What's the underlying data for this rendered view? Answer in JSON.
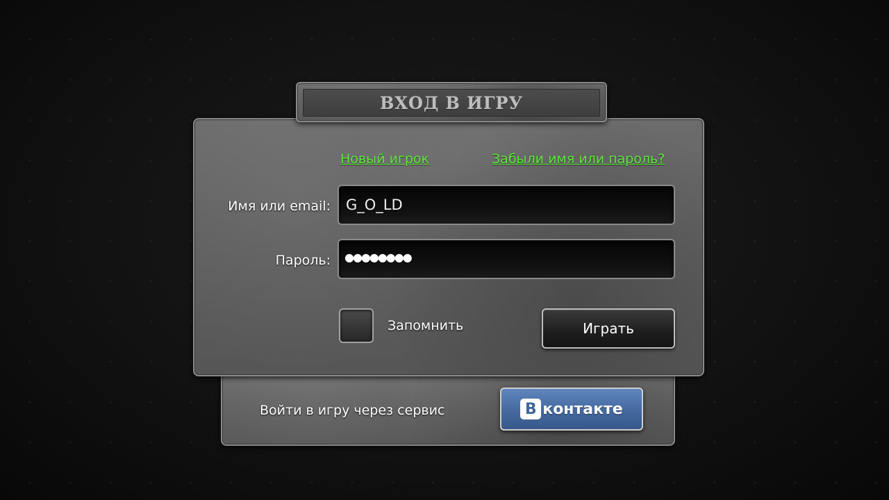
{
  "title": "ВХОД В ИГРУ",
  "links": {
    "new_player": "Новый игрок",
    "forgot": "Забыли имя или пароль?"
  },
  "form": {
    "login_label": "Имя или email:",
    "login_value": "G_O_LD",
    "password_label": "Пароль:",
    "password_mask": "●●●●●●●●",
    "remember_label": "Запомнить",
    "remember_checked": false,
    "play_button": "Играть"
  },
  "social": {
    "via_label": "Войти в игру через сервис",
    "vk_letter": "В",
    "vk_text": "контакте"
  },
  "colors": {
    "link": "#5bea3a",
    "vk_blue": "#45679b"
  }
}
